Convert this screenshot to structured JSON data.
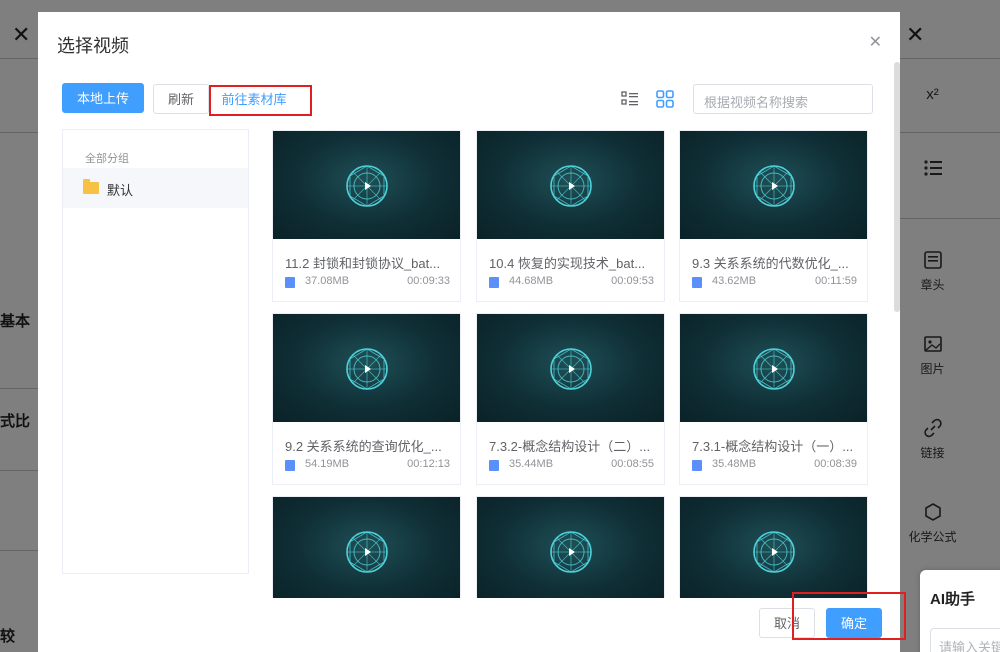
{
  "background": {
    "left_texts": [
      "基本",
      "式比",
      "较"
    ],
    "toolbar": [
      {
        "label": "",
        "icon": "superscript-icon"
      },
      {
        "label": "",
        "icon": "list-icon"
      },
      {
        "label": "章头",
        "icon": "chapter-icon"
      },
      {
        "label": "图片",
        "icon": "image-icon"
      },
      {
        "label": "链接",
        "icon": "link-icon"
      },
      {
        "label": "化学公式",
        "icon": "hexagon-icon"
      }
    ],
    "superscript_text": "x²",
    "ai_panel": {
      "title": "AI助手",
      "placeholder": "请输入关键"
    }
  },
  "dialog": {
    "title": "选择视频",
    "upload_label": "本地上传",
    "refresh_label": "刷新",
    "library_link": "前往素材库",
    "search_placeholder": "根据视频名称搜索",
    "sidebar": {
      "header": "全部分组",
      "items": [
        {
          "label": "默认"
        }
      ]
    },
    "videos": [
      {
        "title": "11.2 封锁和封锁协议_bat...",
        "size": "37.08MB",
        "duration": "00:09:33"
      },
      {
        "title": "10.4 恢复的实现技术_bat...",
        "size": "44.68MB",
        "duration": "00:09:53"
      },
      {
        "title": "9.3 关系系统的代数优化_...",
        "size": "43.62MB",
        "duration": "00:11:59"
      },
      {
        "title": "9.2 关系系统的查询优化_...",
        "size": "54.19MB",
        "duration": "00:12:13"
      },
      {
        "title": "7.3.2-概念结构设计（二）...",
        "size": "35.44MB",
        "duration": "00:08:55"
      },
      {
        "title": "7.3.1-概念结构设计（一）...",
        "size": "35.48MB",
        "duration": "00:08:39"
      },
      {
        "title": "",
        "size": "",
        "duration": ""
      },
      {
        "title": "",
        "size": "",
        "duration": ""
      },
      {
        "title": "",
        "size": "",
        "duration": ""
      }
    ],
    "cancel_label": "取消",
    "confirm_label": "确定"
  },
  "colors": {
    "primary": "#409eff",
    "highlight_box": "#e02020",
    "thumb": "#0f2e35",
    "thumb_accent": "#4fd1d9"
  }
}
